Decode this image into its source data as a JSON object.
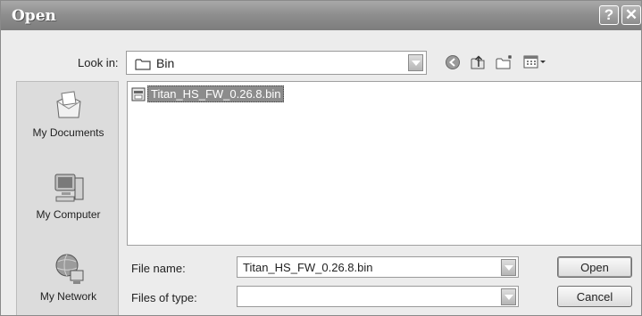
{
  "window": {
    "title": "Open",
    "help_glyph": "?",
    "close_glyph": "✕"
  },
  "toolbar": {
    "look_in_label": "Look in:",
    "look_in_value": "Bin",
    "icons": [
      "folder-icon",
      "back-icon",
      "up-folder-icon",
      "new-folder-icon",
      "views-menu-icon"
    ]
  },
  "places": [
    {
      "label": "My Documents",
      "icon": "my-documents-icon"
    },
    {
      "label": "My Computer",
      "icon": "my-computer-icon"
    },
    {
      "label": "My Network",
      "icon": "my-network-icon"
    }
  ],
  "files": [
    {
      "name": "Titan_HS_FW_0.26.8.bin",
      "icon": "bin-file-icon",
      "selected": true
    }
  ],
  "form": {
    "file_name_label": "File name:",
    "file_name_value": "Titan_HS_FW_0.26.8.bin",
    "file_type_label": "Files of type:",
    "file_type_value": ""
  },
  "buttons": {
    "open_label": "Open",
    "cancel_label": "Cancel"
  }
}
